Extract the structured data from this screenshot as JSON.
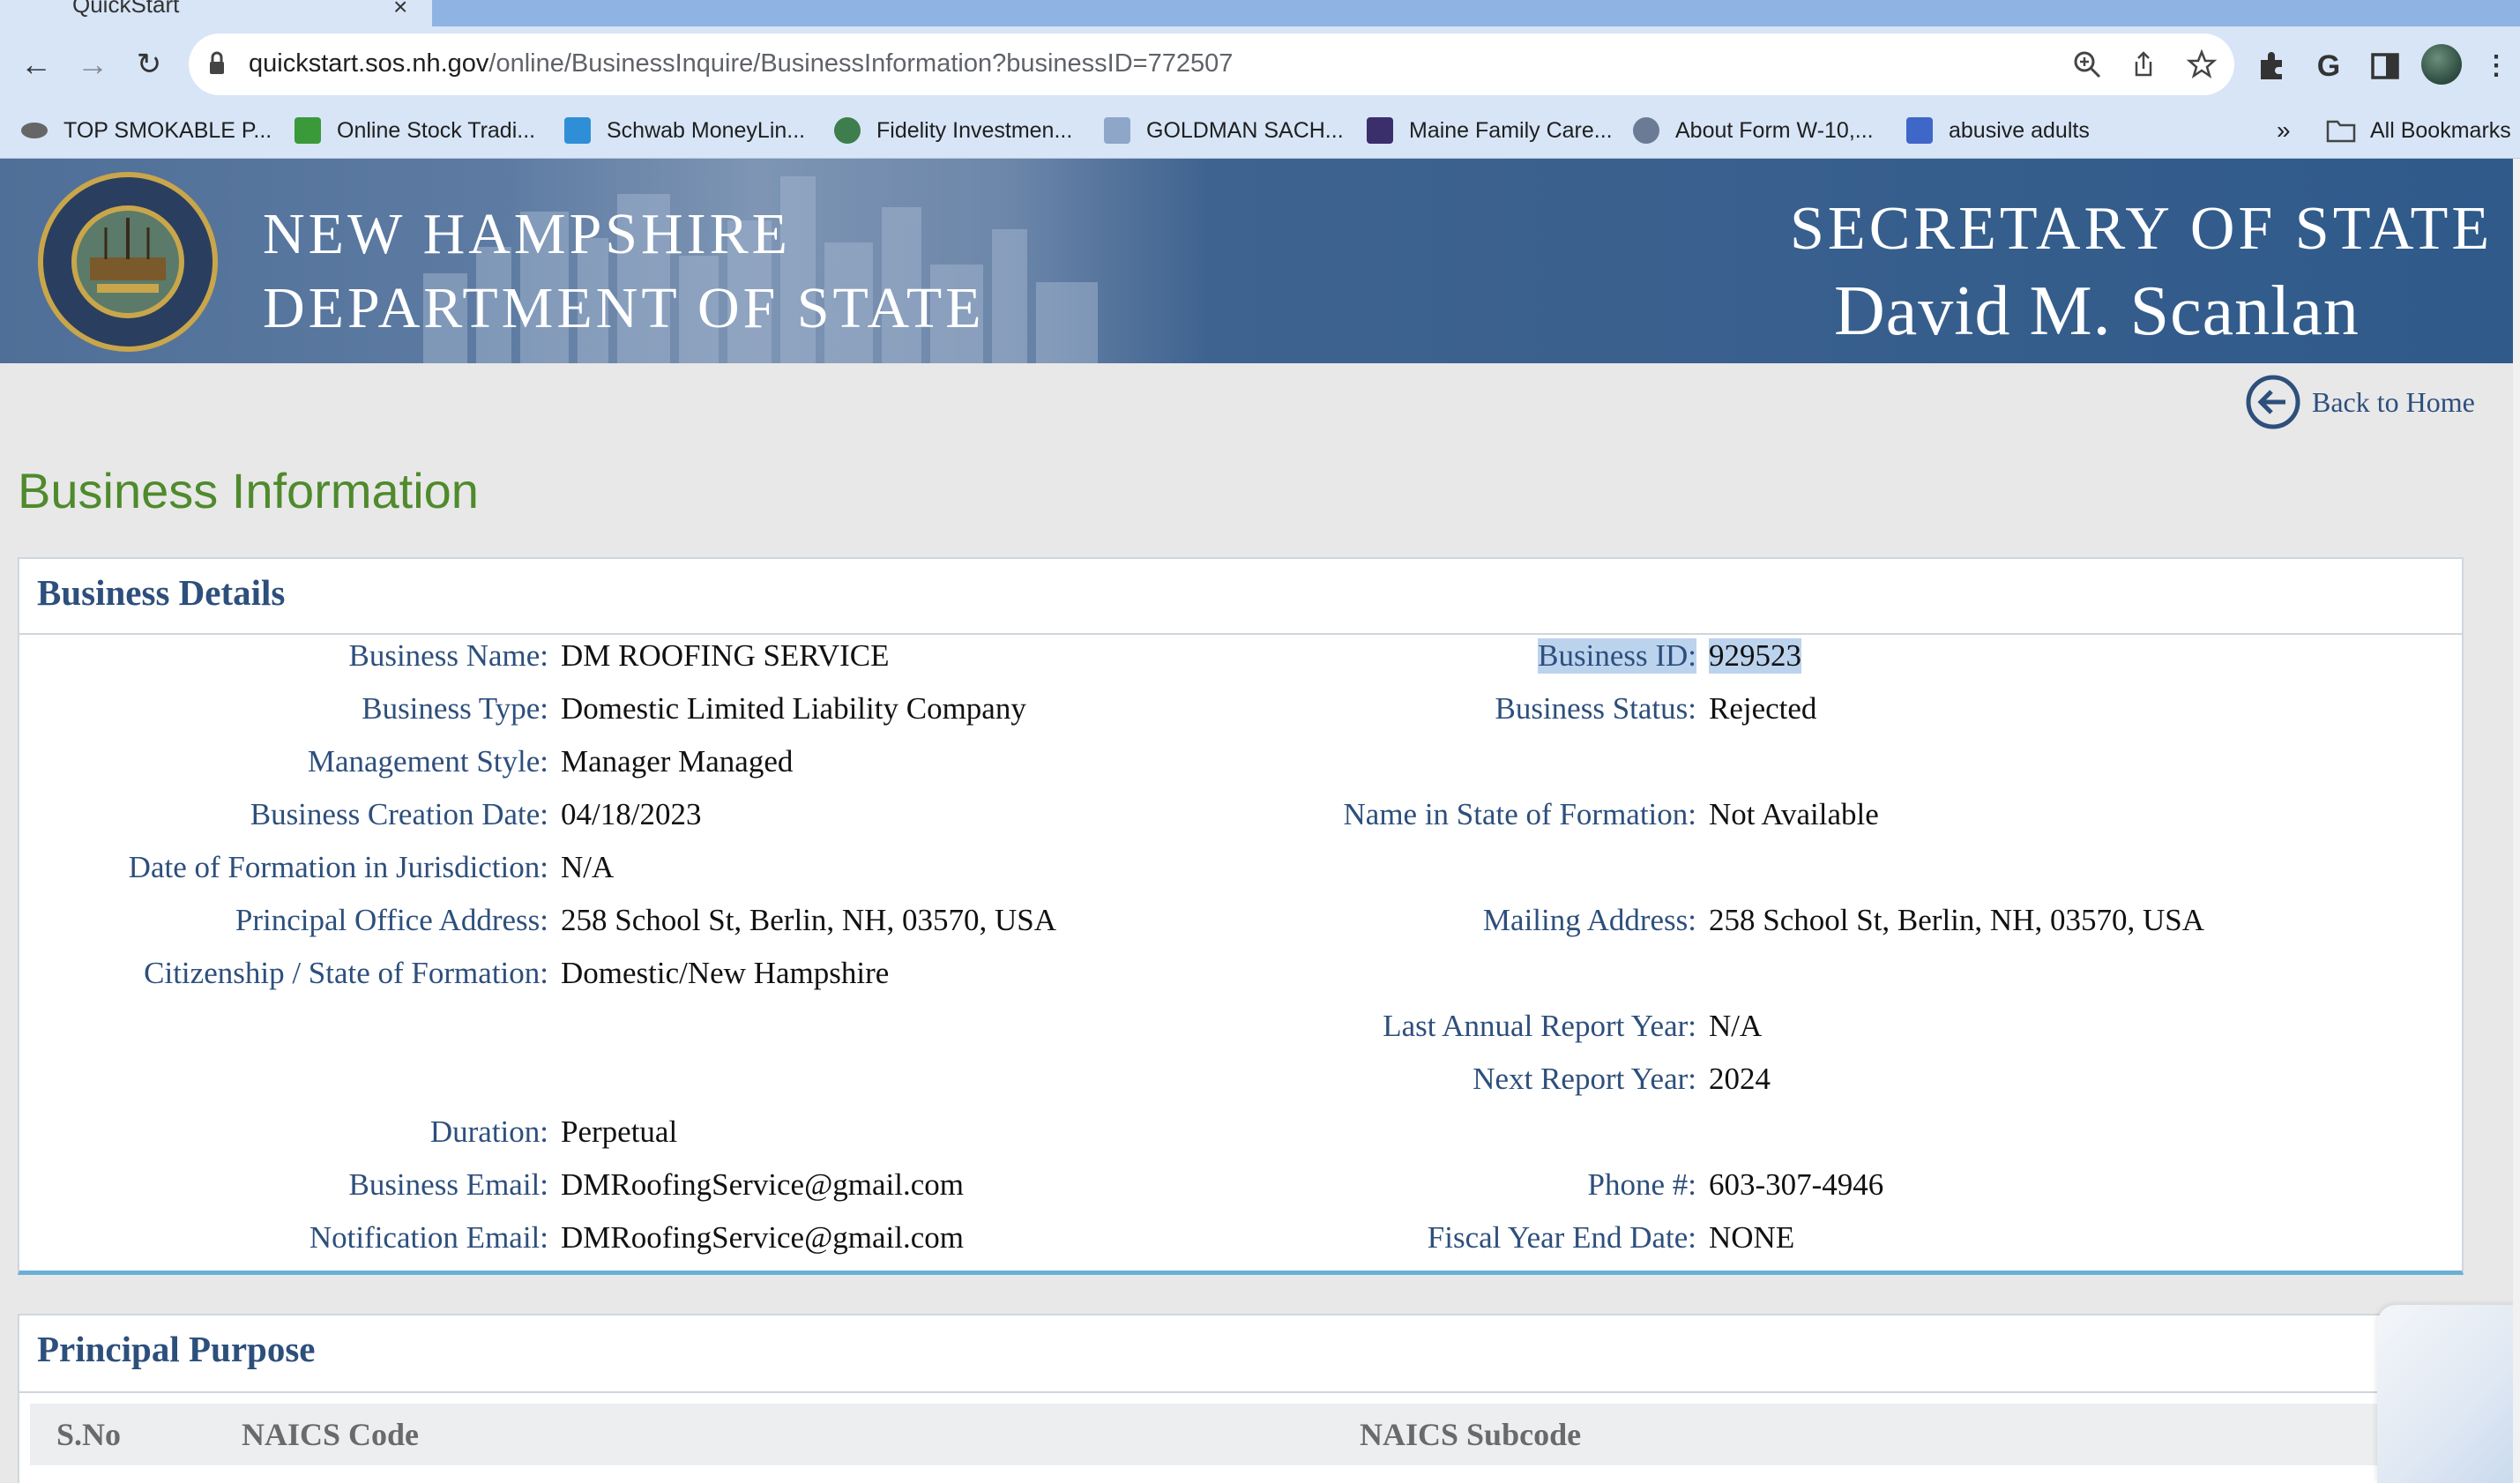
{
  "browser": {
    "tab_title": "QuickStart",
    "tab_close": "×",
    "url_domain": "quickstart.sos.nh.gov",
    "url_path": "/online/BusinessInquire/BusinessInformation?businessID=772507",
    "bookmarks": [
      {
        "label": "TOP SMOKABLE P...",
        "icon": "eye-icon",
        "color": "#555555"
      },
      {
        "label": "Online Stock Tradi...",
        "icon": "td-icon",
        "color": "#3a9a3a"
      },
      {
        "label": "Schwab MoneyLin...",
        "icon": "schwab-icon",
        "color": "#2f8fd6"
      },
      {
        "label": "Fidelity Investmen...",
        "icon": "fidelity-icon",
        "color": "#3e7d4c"
      },
      {
        "label": "GOLDMAN SACH...",
        "icon": "goldman-icon",
        "color": "#8ea6c8"
      },
      {
        "label": "Maine Family Care...",
        "icon": "maine-icon",
        "color": "#3a2f6b"
      },
      {
        "label": "About Form W-10,...",
        "icon": "irs-icon",
        "color": "#6b7b95"
      },
      {
        "label": "abusive adults",
        "icon": "pt-icon",
        "color": "#3f67c7"
      }
    ],
    "overflow_label": "»",
    "all_bookmarks_label": "All Bookmarks"
  },
  "banner": {
    "dept_line1": "NEW HAMPSHIRE",
    "dept_line2": "DEPARTMENT OF STATE",
    "office": "SECRETARY OF STATE",
    "officer": "David M. Scanlan"
  },
  "page": {
    "back_home": "Back to Home",
    "title": "Business Information"
  },
  "details": {
    "heading": "Business Details",
    "left": [
      {
        "label": "Business Name:",
        "value": "DM ROOFING SERVICE"
      },
      {
        "label": "Business Type:",
        "value": "Domestic Limited Liability Company"
      },
      {
        "label": "Management Style:",
        "value": "Manager Managed"
      },
      {
        "label": "Business Creation Date:",
        "value": "04/18/2023"
      },
      {
        "label": "Date of Formation in Jurisdiction:",
        "value": "N/A"
      },
      {
        "label": "Principal Office Address:",
        "value": "258 School St, Berlin, NH, 03570, USA"
      },
      {
        "label": "Citizenship / State of Formation:",
        "value": "Domestic/New Hampshire"
      },
      {
        "label": "Duration:",
        "value": "Perpetual"
      },
      {
        "label": "Business Email:",
        "value": "DMRoofingService@gmail.com"
      },
      {
        "label": "Notification Email:",
        "value": "DMRoofingService@gmail.com"
      }
    ],
    "right": [
      {
        "label": "Business ID:",
        "value": "929523"
      },
      {
        "label": "Business Status:",
        "value": "Rejected"
      },
      {
        "label": "Name in State of Formation:",
        "value": "Not Available"
      },
      {
        "label": "Mailing Address:",
        "value": "258 School St, Berlin, NH, 03570, USA"
      },
      {
        "label": "Last Annual Report Year:",
        "value": "N/A"
      },
      {
        "label": "Next Report Year:",
        "value": "2024"
      },
      {
        "label": "Phone #:",
        "value": "603-307-4946"
      },
      {
        "label": "Fiscal Year End Date:",
        "value": "NONE"
      }
    ]
  },
  "purpose": {
    "heading": "Principal Purpose",
    "columns": [
      "S.No",
      "NAICS Code",
      "NAICS Subcode"
    ]
  }
}
